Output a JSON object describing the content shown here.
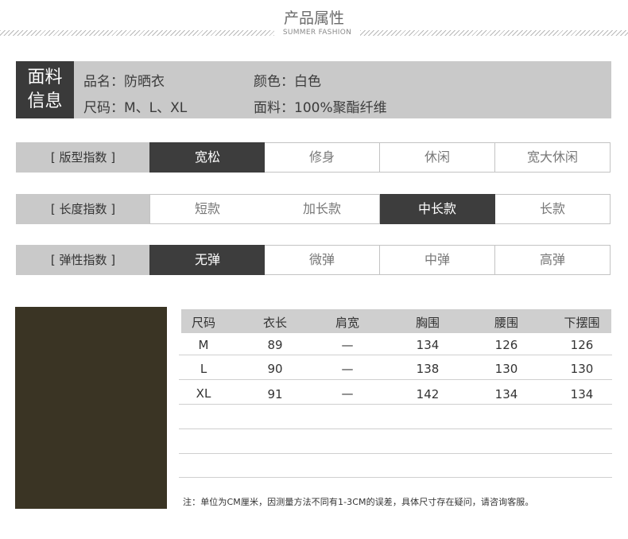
{
  "header": {
    "title": "产品属性",
    "subtitle": "SUMMER FASHION"
  },
  "info": {
    "label_line1": "面料",
    "label_line2": "信息",
    "name": "品名：防晒衣",
    "color": "颜色：白色",
    "sizes": "尺码：M、L、XL",
    "fabric": "面料：100%聚酯纤维"
  },
  "indices": [
    {
      "label": "[  版型指数  ]",
      "options": [
        "宽松",
        "修身",
        "休闲",
        "宽大休闲"
      ],
      "selected": 0
    },
    {
      "label": "[  长度指数  ]",
      "options": [
        "短款",
        "加长款",
        "中长款",
        "长款"
      ],
      "selected": 2
    },
    {
      "label": "[  弹性指数  ]",
      "options": [
        "无弹",
        "微弹",
        "中弹",
        "高弹"
      ],
      "selected": 0
    }
  ],
  "size_table": {
    "headers": [
      "尺码",
      "衣长",
      "肩宽",
      "胸围",
      "腰围",
      "下摆围"
    ],
    "rows": [
      [
        "M",
        "89",
        "—",
        "134",
        "126",
        "126"
      ],
      [
        "L",
        "90",
        "—",
        "138",
        "130",
        "130"
      ],
      [
        "XL",
        "91",
        "—",
        "142",
        "134",
        "134"
      ]
    ]
  },
  "note": "注：单位为CM厘米，因测量方法不同有1-3CM的误差，具体尺寸存在疑问，请咨询客服。",
  "colors": {
    "dark": "#3d3d3d",
    "gray": "#c9c9c9",
    "photo": "#3a3424"
  }
}
